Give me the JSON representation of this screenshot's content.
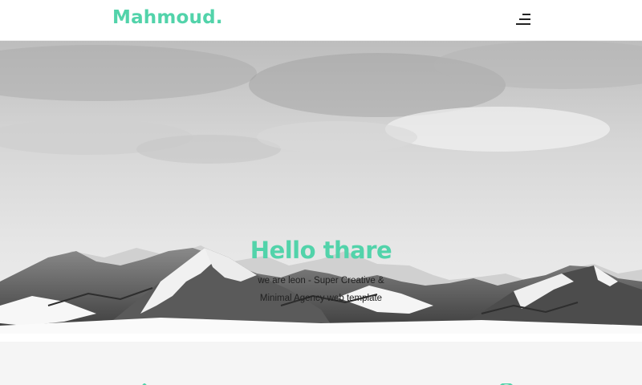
{
  "header": {
    "logo": "Mahmoud.",
    "menu_icon": "hamburger-menu-icon"
  },
  "hero": {
    "title": "Hello thare",
    "subtitle_line1": "we are leon - Super Creative &",
    "subtitle_line2": "Minimal Agency web template",
    "background": "snowy-mountain-photo"
  },
  "services": {
    "icons": [
      "triangle-icon",
      "square-icon",
      "circle-icon"
    ]
  },
  "colors": {
    "accent": "#52d3aa",
    "text_dark": "#222222",
    "section_bg": "#f5f5f5"
  }
}
